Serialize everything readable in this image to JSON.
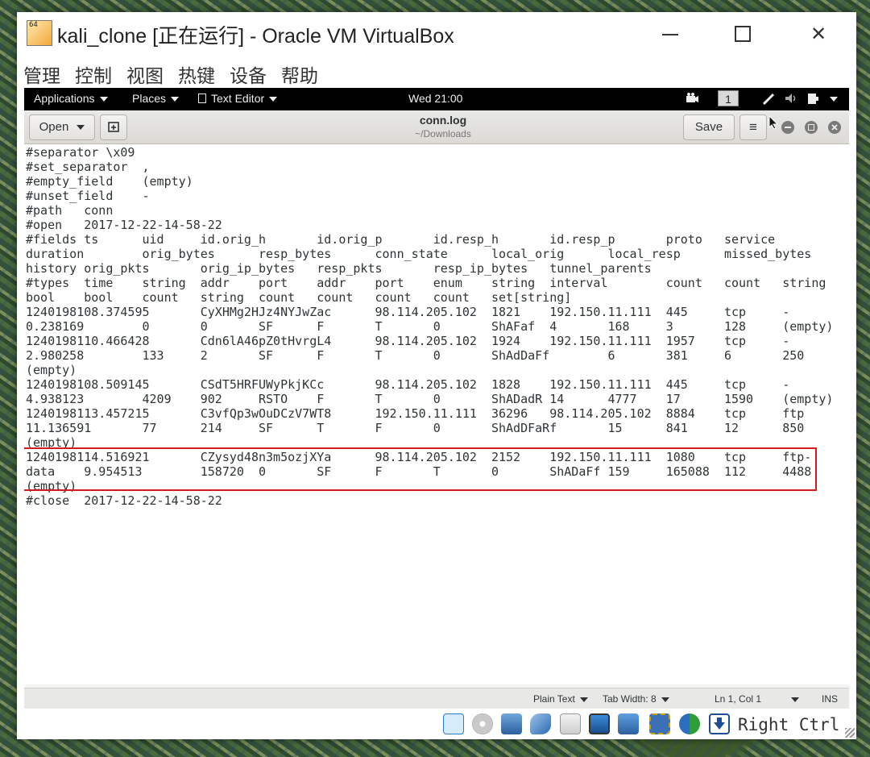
{
  "window": {
    "app_icon_badge": "64",
    "title": "kali_clone [正在运行] - Oracle VM VirtualBox",
    "close_glyph": "✕"
  },
  "vbox_menu": [
    "管理",
    "控制",
    "视图",
    "热键",
    "设备",
    "帮助"
  ],
  "gnome_bar": {
    "applications": "Applications",
    "places": "Places",
    "text_editor": "Text Editor",
    "clock": "Wed 21:00",
    "workspace": "1"
  },
  "gedit": {
    "open_label": "Open",
    "save_label": "Save",
    "doc_title": "conn.log",
    "doc_path": "~/Downloads",
    "menu_glyph": "≡"
  },
  "editor_lines": [
    "#separator \\x09",
    "#set_separator  ,",
    "#empty_field    (empty)",
    "#unset_field    -",
    "#path   conn",
    "#open   2017-12-22-14-58-22",
    "#fields ts      uid     id.orig_h       id.orig_p       id.resp_h       id.resp_p       proto   service",
    "duration        orig_bytes      resp_bytes      conn_state      local_orig      local_resp      missed_bytes",
    "history orig_pkts       orig_ip_bytes   resp_pkts       resp_ip_bytes   tunnel_parents",
    "#types  time    string  addr    port    addr    port    enum    string  interval        count   count   string",
    "bool    bool    count   string  count   count   count   count   set[string]",
    "1240198108.374595       CyXHMg2HJz4NYJwZac      98.114.205.102  1821    192.150.11.111  445     tcp     -",
    "0.238169        0       0       SF      F       T       0       ShAFaf  4       168     3       128     (empty)",
    "1240198110.466428       Cdn6lA46pZ0tHvrgL4      98.114.205.102  1924    192.150.11.111  1957    tcp     -",
    "2.980258        133     2       SF      F       T       0       ShAdDaFf        6       381     6       250",
    "(empty)",
    "1240198108.509145       CSdT5HRFUWyPkjKCc       98.114.205.102  1828    192.150.11.111  445     tcp     -",
    "4.938123        4209    902     RSTO    F       T       0       ShADadR 14      4777    17      1590    (empty)",
    "1240198113.457215       C3vfQp3wOuDCzV7WT8      192.150.11.111  36296   98.114.205.102  8884    tcp     ftp",
    "11.136591       77      214     SF      T       F       0       ShAdDFaRf       15      841     12      850",
    "(empty)",
    "1240198114.516921       CZysyd48n3m5ozjXYa      98.114.205.102  2152    192.150.11.111  1080    tcp     ftp-",
    "data    9.954513        158720  0       SF      F       T       0       ShADaFf 159     165088  112     4488",
    "(empty)",
    "#close  2017-12-22-14-58-22"
  ],
  "statusbar": {
    "syntax": "Plain Text",
    "tab_width": "Tab Width: 8",
    "position": "Ln 1, Col 1",
    "mode": "INS"
  },
  "vbox_status": {
    "host_key": "Right Ctrl",
    "icons": [
      "hard-disk-icon",
      "optical-drive-icon",
      "network-icon",
      "usb-icon",
      "shared-folders-icon",
      "display-icon",
      "video-capture-icon",
      "cpu-icon",
      "mouse-integration-icon",
      "keyboard-capture-icon"
    ]
  },
  "colors": {
    "highlight_border": "#d41a1a",
    "gnome_bar": "#000000"
  }
}
